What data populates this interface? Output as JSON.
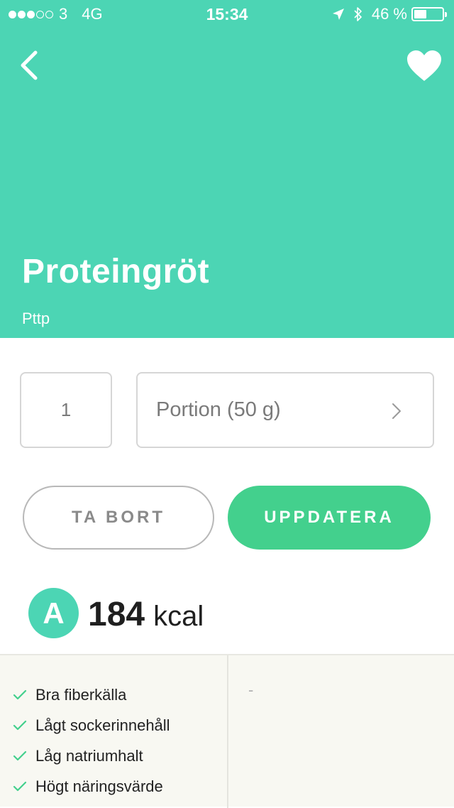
{
  "status_bar": {
    "signal_filled": 3,
    "signal_total": 5,
    "carrier": "3",
    "network": "4G",
    "time": "15:34",
    "battery_percent_label": "46 %",
    "battery_level": 0.46
  },
  "header": {
    "background_color": "#4cd5b4",
    "title": "Proteingröt",
    "subtitle": "Pttp",
    "back_icon": "chevron-left-icon",
    "favorite_icon": "heart-icon"
  },
  "portion": {
    "quantity": "1",
    "unit": "Portion (50 g)"
  },
  "actions": {
    "remove_label": "TA BORT",
    "update_label": "UPPDATERA",
    "update_color": "#43d08d"
  },
  "nutrition": {
    "grade": "A",
    "kcal_value": "184",
    "kcal_unit": "kcal"
  },
  "benefits": [
    "Bra fiberkälla",
    "Lågt sockerinnehåll",
    "Låg natriumhalt",
    "Högt näringsvärde"
  ],
  "drawbacks_placeholder": "-"
}
